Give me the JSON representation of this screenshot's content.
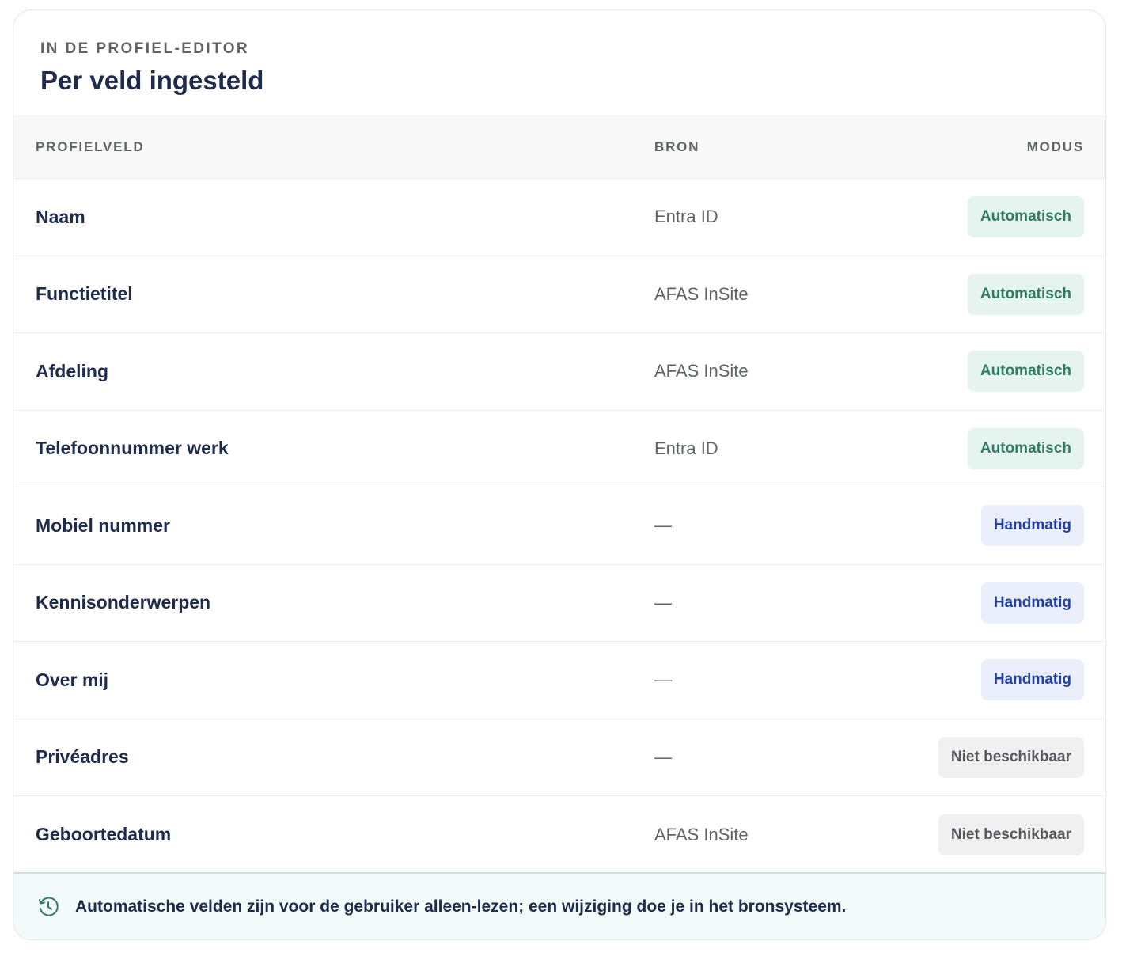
{
  "header": {
    "eyebrow": "IN DE PROFIEL-EDITOR",
    "title": "Per veld ingesteld"
  },
  "table": {
    "columns": {
      "field": "PROFIELVELD",
      "source": "BRON",
      "mode": "MODUS"
    },
    "rows": [
      {
        "field": "Naam",
        "source": "Entra ID",
        "mode": "Automatisch",
        "mode_type": "auto"
      },
      {
        "field": "Functietitel",
        "source": "AFAS InSite",
        "mode": "Automatisch",
        "mode_type": "auto"
      },
      {
        "field": "Afdeling",
        "source": "AFAS InSite",
        "mode": "Automatisch",
        "mode_type": "auto"
      },
      {
        "field": "Telefoonnummer werk",
        "source": "Entra ID",
        "mode": "Automatisch",
        "mode_type": "auto"
      },
      {
        "field": "Mobiel nummer",
        "source": "—",
        "mode": "Handmatig",
        "mode_type": "manual"
      },
      {
        "field": "Kennisonderwerpen",
        "source": "—",
        "mode": "Handmatig",
        "mode_type": "manual"
      },
      {
        "field": "Over mij",
        "source": "—",
        "mode": "Handmatig",
        "mode_type": "manual"
      },
      {
        "field": "Privéadres",
        "source": "—",
        "mode": "Niet beschikbaar",
        "mode_type": "na"
      },
      {
        "field": "Geboortedatum",
        "source": "AFAS InSite",
        "mode": "Niet beschikbaar",
        "mode_type": "na"
      }
    ]
  },
  "footer": {
    "icon": "history-clock-icon",
    "text": "Automatische velden zijn voor de gebruiker alleen-lezen; een wijziging doe je in het bronsysteem."
  },
  "colors": {
    "auto_bg": "#e5f4ee",
    "auto_text": "#2f7a64",
    "manual_bg": "#eaeffb",
    "manual_text": "#2340a8",
    "na_bg": "#f0f0f1",
    "na_text": "#55595f",
    "footer_icon": "#2f7a64"
  }
}
